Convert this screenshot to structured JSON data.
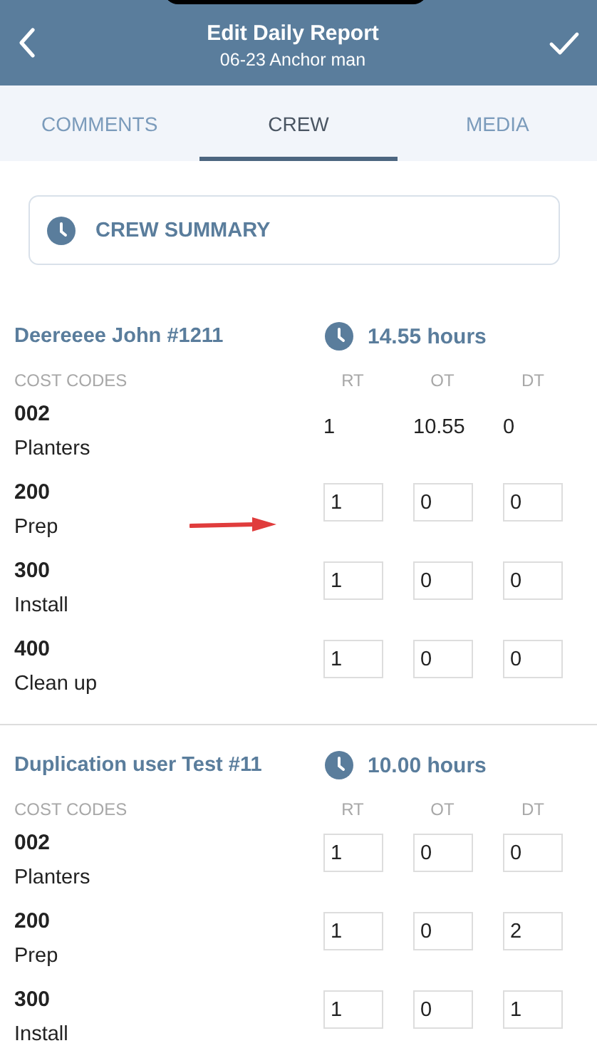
{
  "header": {
    "title": "Edit Daily Report",
    "subtitle": "06-23 Anchor man"
  },
  "tabs": [
    {
      "label": "COMMENTS",
      "selected": false
    },
    {
      "label": "CREW",
      "selected": true
    },
    {
      "label": "MEDIA",
      "selected": false
    }
  ],
  "summary_button": {
    "label": "CREW SUMMARY"
  },
  "crew": [
    {
      "name": "Deereeee John #1211",
      "hours": "14.55 hours",
      "columns": [
        "COST CODES",
        "RT",
        "OT",
        "DT"
      ],
      "rows": [
        {
          "code": "002",
          "description": "Planters",
          "kind": "text",
          "values": [
            "1",
            "10.55",
            "0"
          ]
        },
        {
          "code": "200",
          "description": "Prep",
          "kind": "input",
          "values": [
            "1",
            "0",
            "0"
          ]
        },
        {
          "code": "300",
          "description": "Install",
          "kind": "input",
          "values": [
            "1",
            "0",
            "0"
          ]
        },
        {
          "code": "400",
          "description": "Clean up",
          "kind": "input",
          "values": [
            "1",
            "0",
            "0"
          ]
        }
      ]
    },
    {
      "name": "Duplication user Test  #11",
      "hours": "10.00 hours",
      "columns": [
        "COST CODES",
        "RT",
        "OT",
        "DT"
      ],
      "rows": [
        {
          "code": "002",
          "description": "Planters",
          "kind": "input",
          "values": [
            "1",
            "0",
            "0"
          ]
        },
        {
          "code": "200",
          "description": "Prep",
          "kind": "input",
          "values": [
            "1",
            "0",
            "2"
          ]
        },
        {
          "code": "300",
          "description": "Install",
          "kind": "input",
          "values": [
            "1",
            "0",
            "1"
          ]
        }
      ]
    }
  ]
}
